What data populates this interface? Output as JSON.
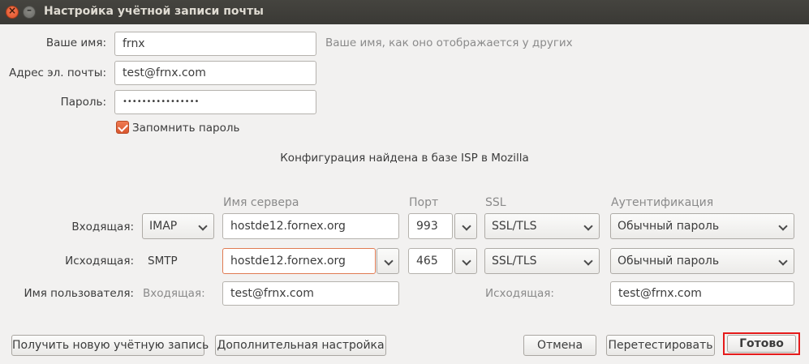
{
  "window": {
    "title": "Настройка учётной записи почты"
  },
  "identity": {
    "name_label": "Ваше имя:",
    "name_value": "frnx",
    "name_hint": "Ваше имя, как оно отображается у других",
    "email_label": "Адрес эл. почты:",
    "email_value": "test@frnx.com",
    "password_label": "Пароль:",
    "password_value": "••••••••••••••••",
    "remember_label": "Запомнить пароль",
    "remember_checked": true
  },
  "status": {
    "message": "Конфигурация найдена в базе ISP в Mozilla"
  },
  "server_table": {
    "headers": {
      "server": "Имя сервера",
      "port": "Порт",
      "ssl": "SSL",
      "auth": "Аутентификация"
    },
    "incoming": {
      "label": "Входящая:",
      "protocol": "IMAP",
      "server": "hostde12.fornex.org",
      "port": "993",
      "ssl": "SSL/TLS",
      "auth": "Обычный пароль"
    },
    "outgoing": {
      "label": "Исходящая:",
      "protocol": "SMTP",
      "server": "hostde12.fornex.org",
      "port": "465",
      "ssl": "SSL/TLS",
      "auth": "Обычный пароль"
    },
    "username": {
      "label": "Имя пользователя:",
      "incoming_label": "Входящая:",
      "incoming_value": "test@frnx.com",
      "outgoing_label": "Исходящая:",
      "outgoing_value": "test@frnx.com"
    }
  },
  "buttons": {
    "new_account": "Получить новую учётную запись",
    "advanced": "Дополнительная настройка",
    "cancel": "Отмена",
    "retest": "Перетестировать",
    "done": "Готово"
  },
  "colors": {
    "accent": "#e07b53",
    "highlight": "#e51b1b",
    "titlebar": "#3c3b37"
  }
}
